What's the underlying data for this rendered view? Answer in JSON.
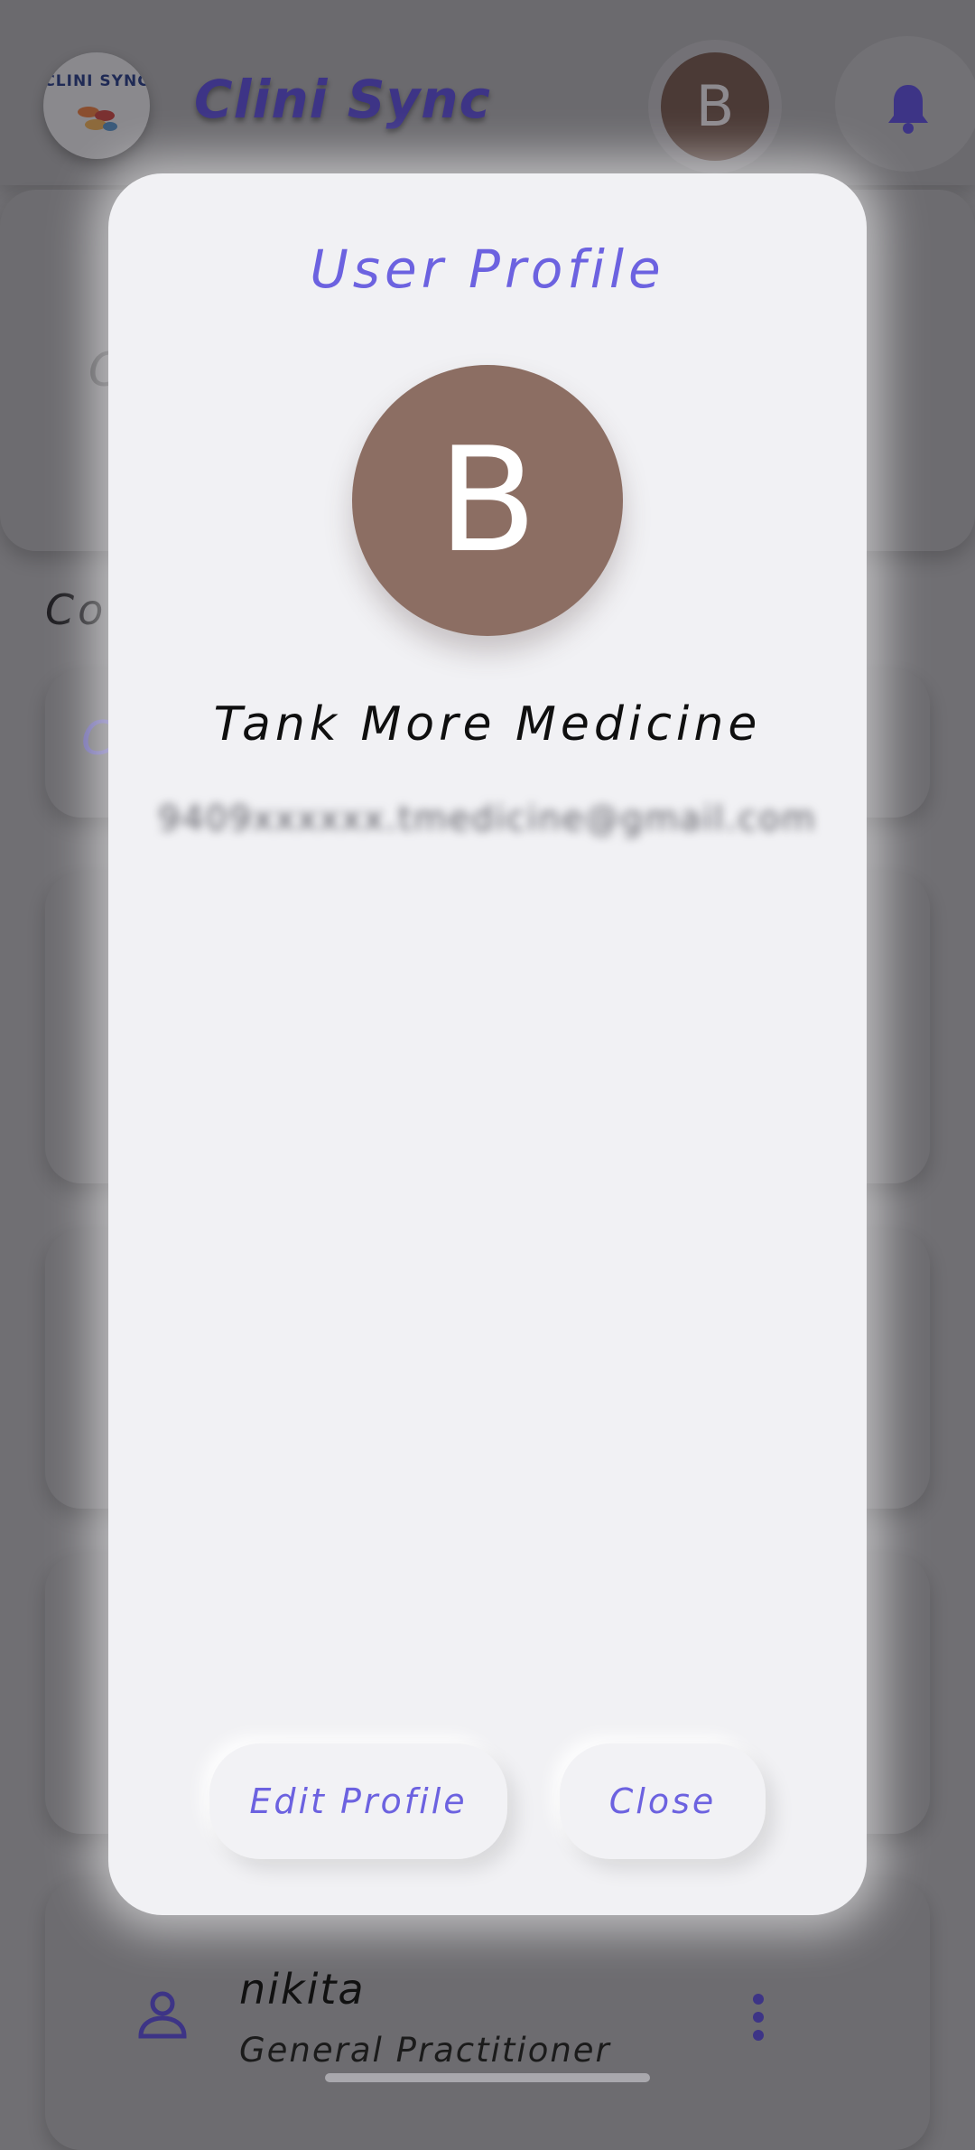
{
  "app": {
    "title": "Clini Sync",
    "logo_text": "CLINI SYNC",
    "avatar_initial": "B"
  },
  "background": {
    "fragments": [
      "O",
      "Co",
      "C"
    ],
    "list_item": {
      "name": "nikita",
      "role": "General Practitioner"
    }
  },
  "modal": {
    "title": "User Profile",
    "avatar_initial": "B",
    "name": "Tank More Medicine",
    "email": "9409xxxxxx.tmedicine@gmail.com",
    "edit_label": "Edit Profile",
    "close_label": "Close"
  },
  "colors": {
    "accent": "#6c62e0",
    "avatar": "#8c6e63",
    "modal_bg": "#f1f1f4",
    "scrim": "#706f73"
  }
}
